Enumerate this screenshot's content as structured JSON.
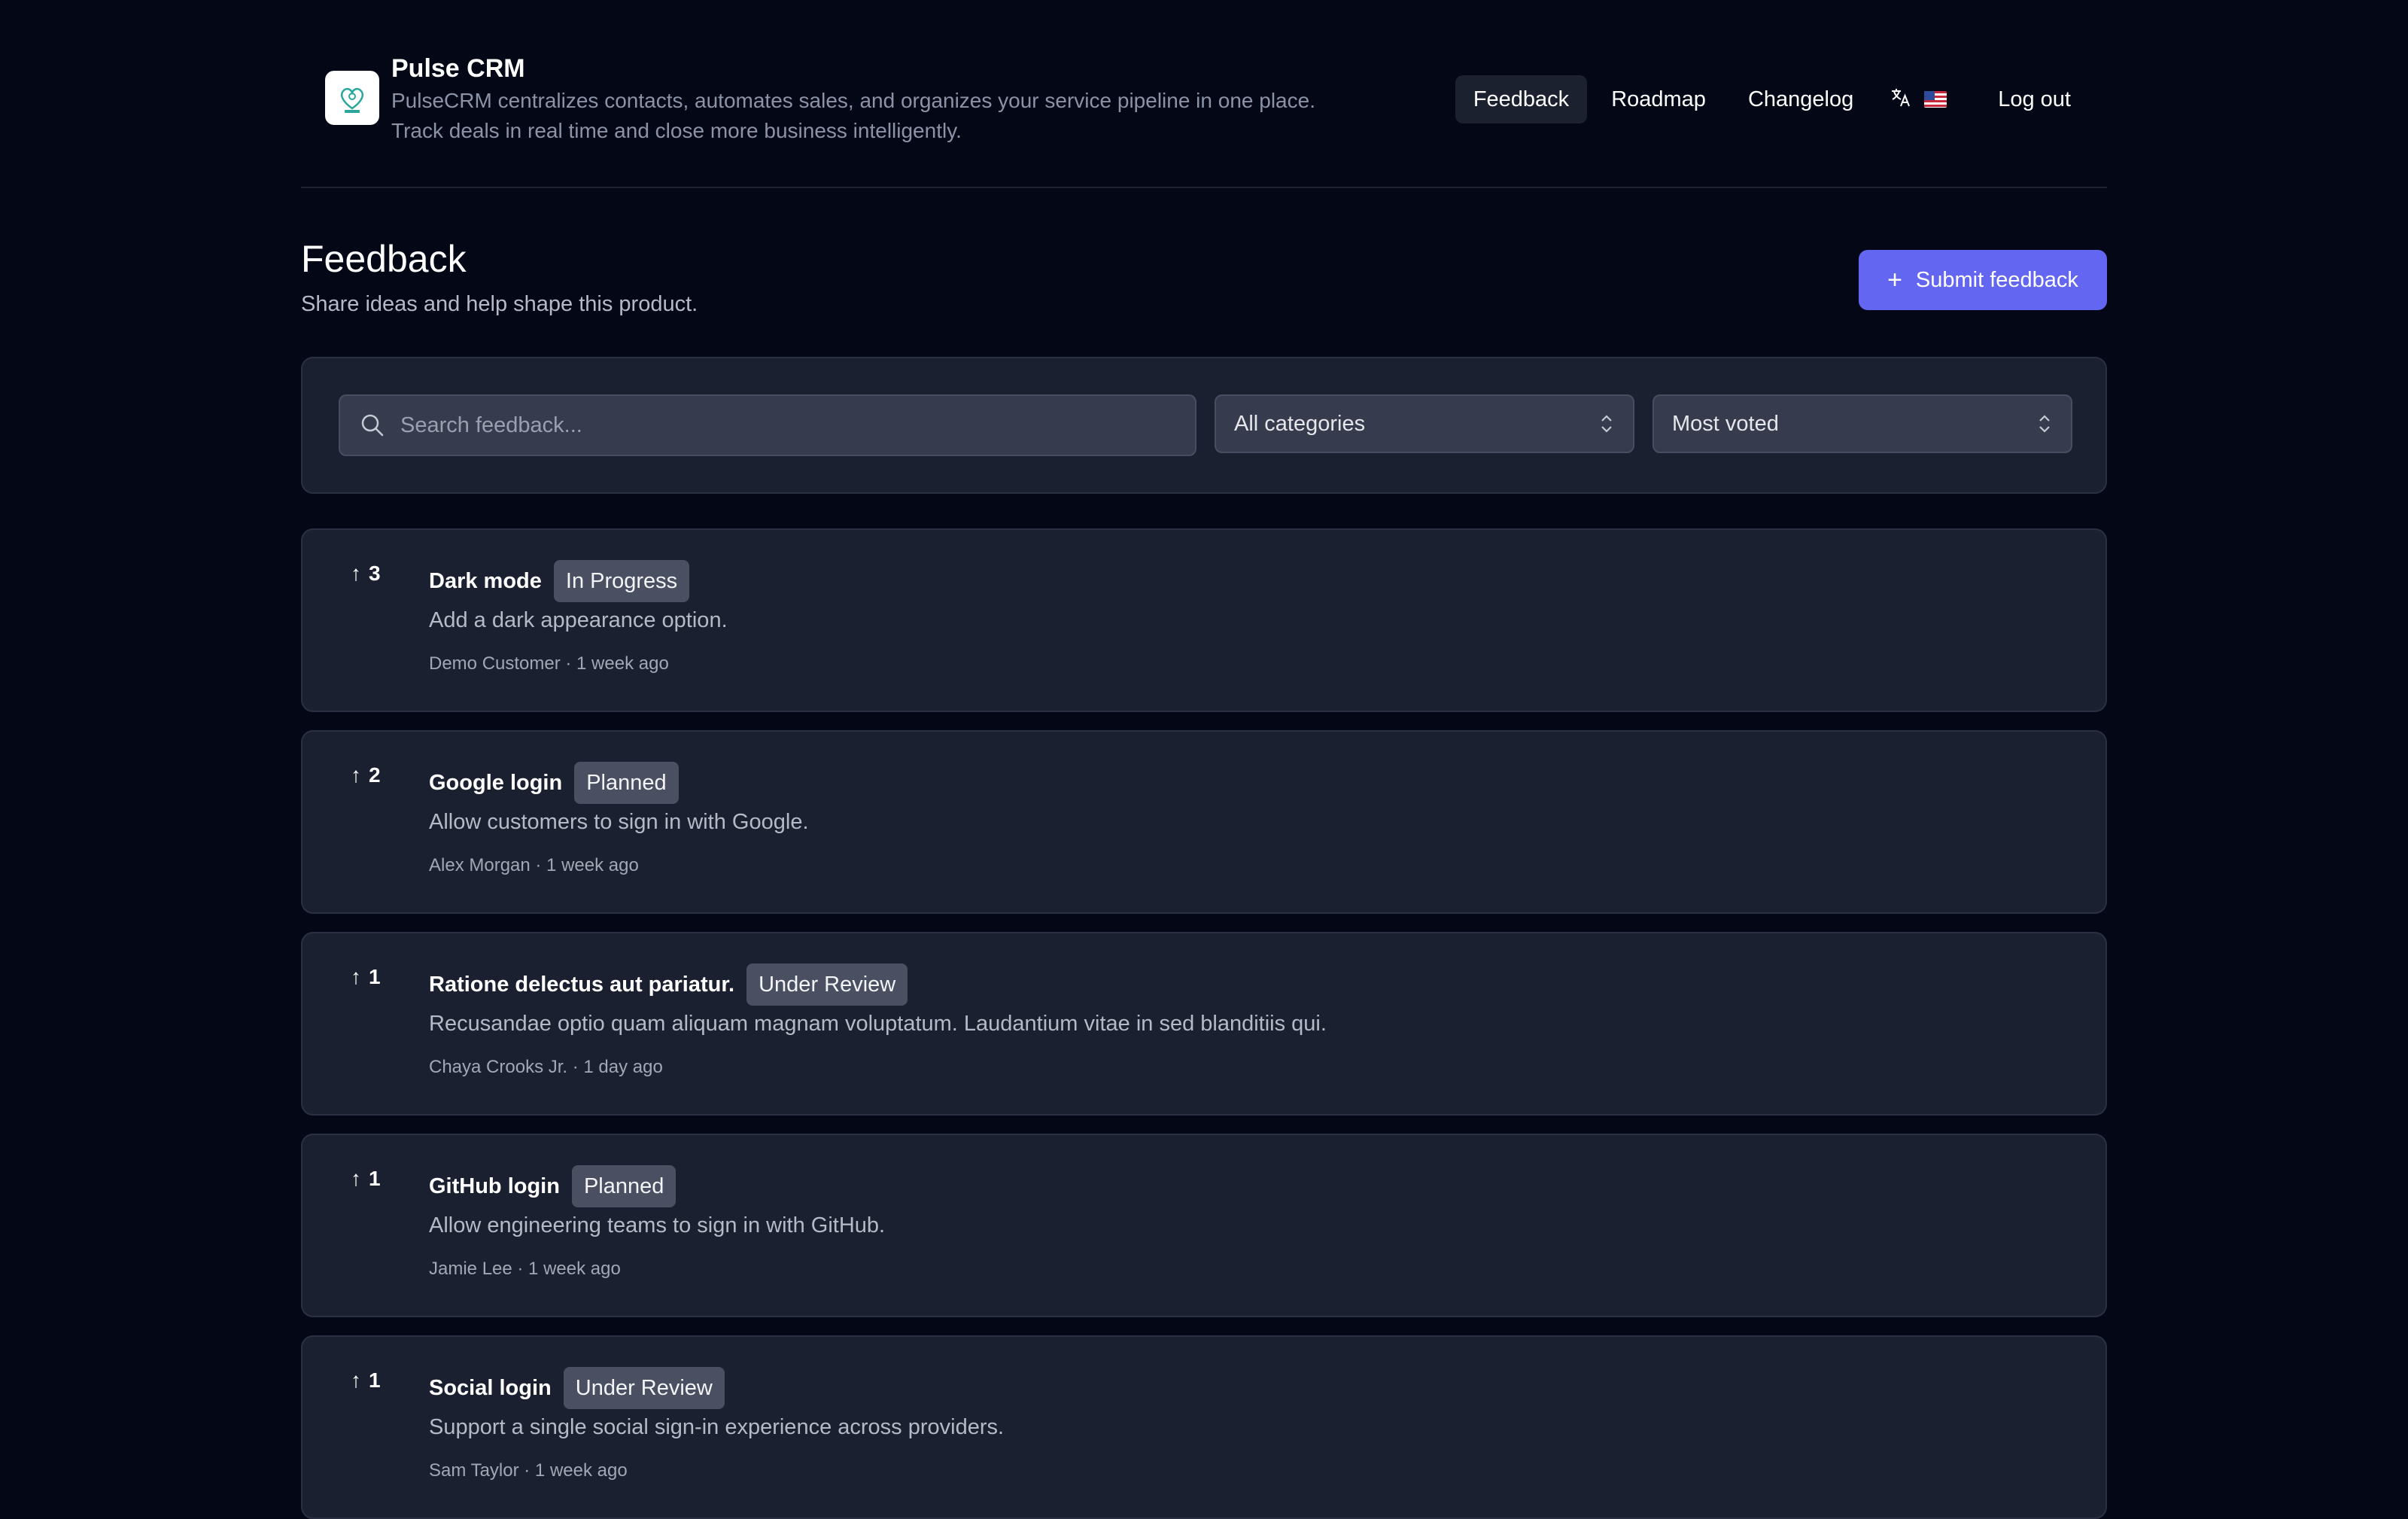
{
  "app": {
    "name": "Pulse CRM",
    "description_line1": "PulseCRM centralizes contacts, automates sales, and organizes your service pipeline in one place.",
    "description_line2": "Track deals in real time and close more business intelligently."
  },
  "nav": {
    "items": [
      "Feedback",
      "Roadmap",
      "Changelog"
    ],
    "active": "Feedback",
    "language_icon": "translate-icon",
    "flag": "us-flag",
    "logout": "Log out"
  },
  "page": {
    "title": "Feedback",
    "subtitle": "Share ideas and help shape this product.",
    "submit_label": "Submit feedback"
  },
  "filters": {
    "search_placeholder": "Search feedback...",
    "category": "All categories",
    "sort": "Most voted"
  },
  "colors": {
    "background": "#040716",
    "card": "#1b2030",
    "accent": "#6366f1",
    "badge": "#4a5062"
  },
  "feedback": [
    {
      "votes": "3",
      "title": "Dark mode",
      "status": "In Progress",
      "description": "Add a dark appearance option.",
      "meta": "Demo Customer · 1 week ago"
    },
    {
      "votes": "2",
      "title": "Google login",
      "status": "Planned",
      "description": "Allow customers to sign in with Google.",
      "meta": "Alex Morgan · 1 week ago"
    },
    {
      "votes": "1",
      "title": "Ratione delectus aut pariatur.",
      "status": "Under Review",
      "description": "Recusandae optio quam aliquam magnam voluptatum. Laudantium vitae in sed blanditiis qui.",
      "meta": "Chaya Crooks Jr. · 1 day ago"
    },
    {
      "votes": "1",
      "title": "GitHub login",
      "status": "Planned",
      "description": "Allow engineering teams to sign in with GitHub.",
      "meta": "Jamie Lee · 1 week ago"
    },
    {
      "votes": "1",
      "title": "Social login",
      "status": "Under Review",
      "description": "Support a single social sign-in experience across providers.",
      "meta": "Sam Taylor · 1 week ago"
    }
  ]
}
